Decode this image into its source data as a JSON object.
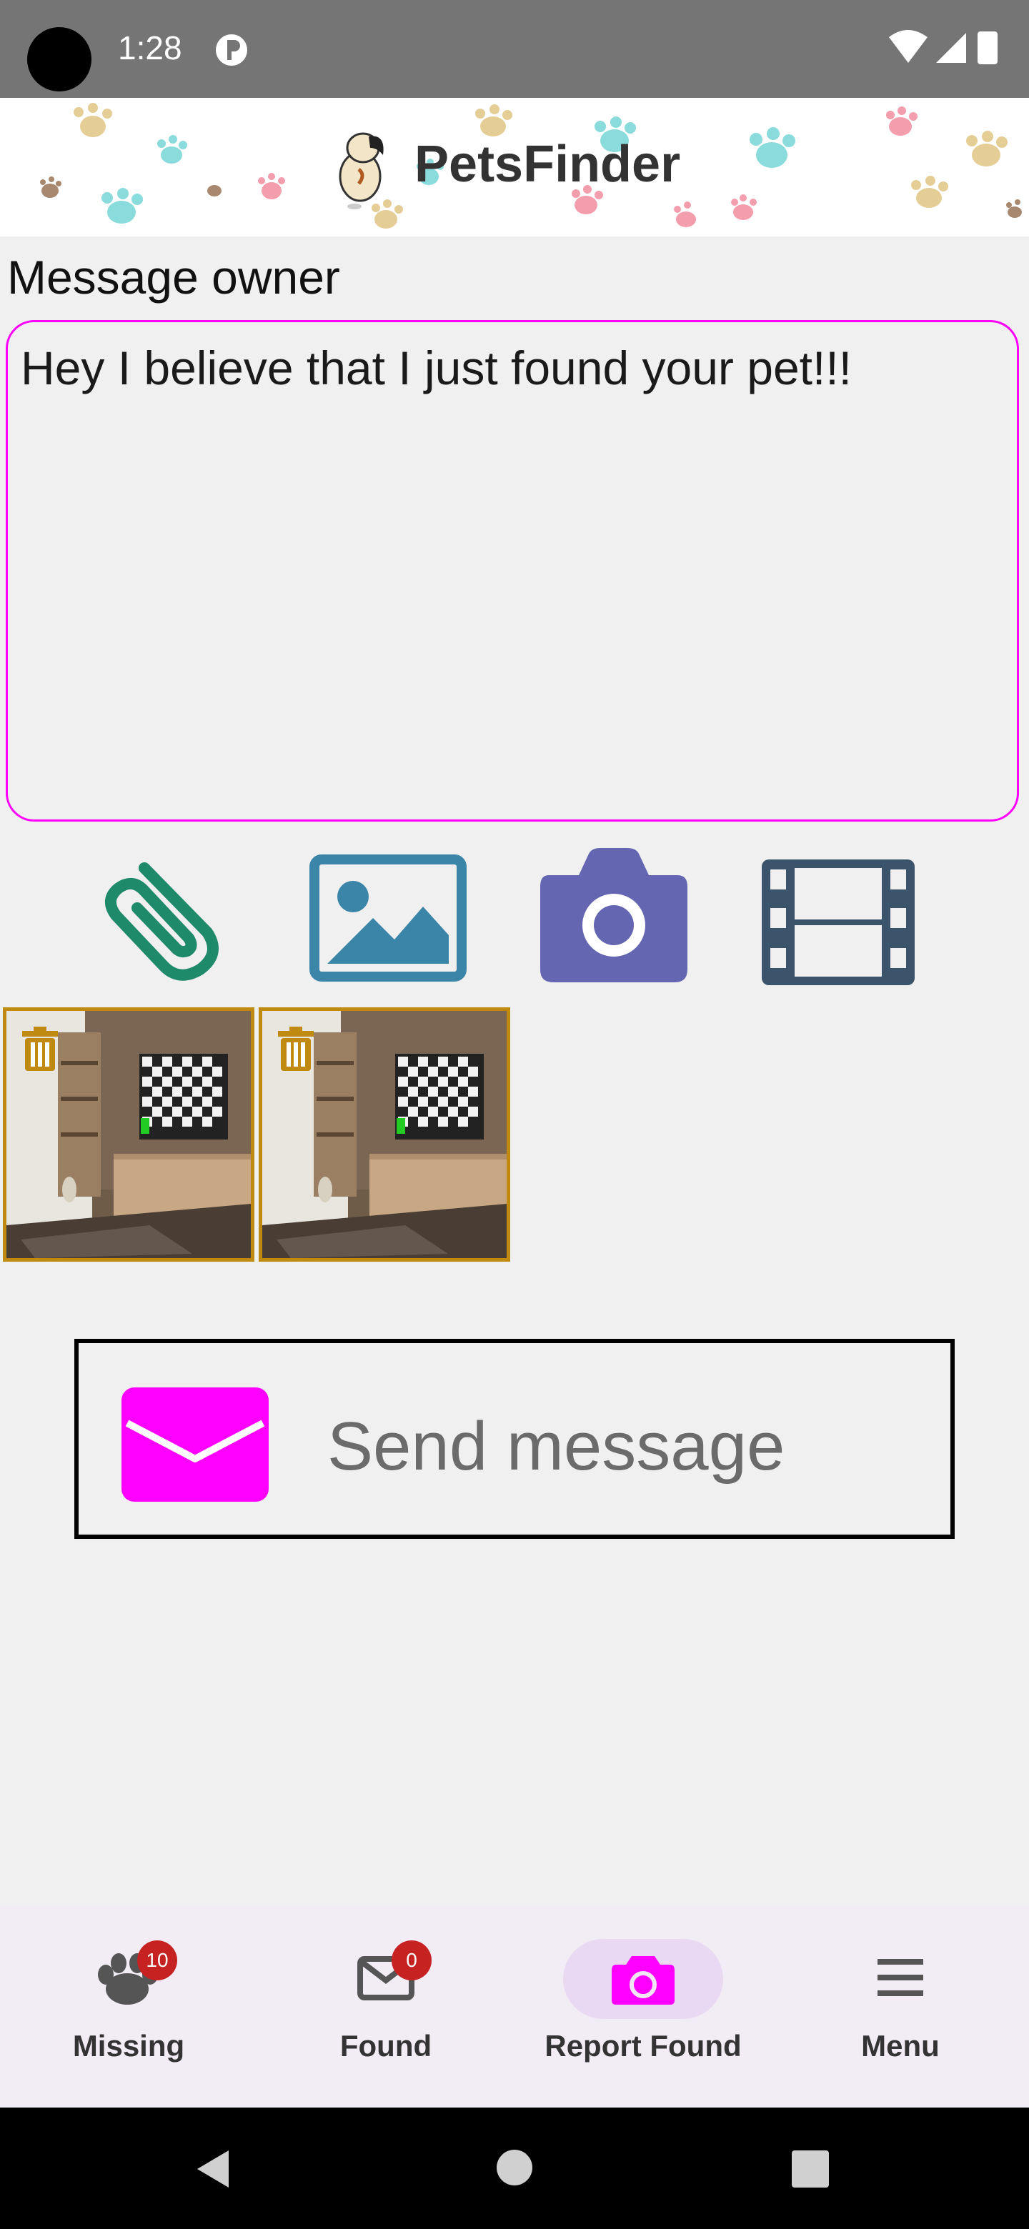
{
  "status_bar": {
    "time": "1:28"
  },
  "header": {
    "title": "PetsFinder",
    "logo_icon": "dog-logo"
  },
  "message": {
    "label": "Message owner",
    "text": "Hey I believe that I just found your pet!!!",
    "border_color": "#ff00ff"
  },
  "attachments": {
    "icons": [
      "paperclip-icon",
      "image-icon",
      "camera-icon",
      "film-icon"
    ],
    "thumbnails": [
      {
        "delete_icon": "trash-icon"
      },
      {
        "delete_icon": "trash-icon"
      }
    ]
  },
  "send": {
    "label": "Send message",
    "icon": "envelope-icon",
    "icon_color": "#ff00ff"
  },
  "bottom_nav": {
    "items": [
      {
        "label": "Missing",
        "badge": "10",
        "icon": "paw-icon"
      },
      {
        "label": "Found",
        "badge": "0",
        "icon": "mail-icon"
      },
      {
        "label": "Report Found",
        "icon": "camera-icon",
        "active": true
      },
      {
        "label": "Menu",
        "icon": "menu-icon"
      }
    ]
  },
  "colors": {
    "accent": "#ff00ff",
    "badge": "#c62222",
    "thumb_border": "#c08a10"
  }
}
